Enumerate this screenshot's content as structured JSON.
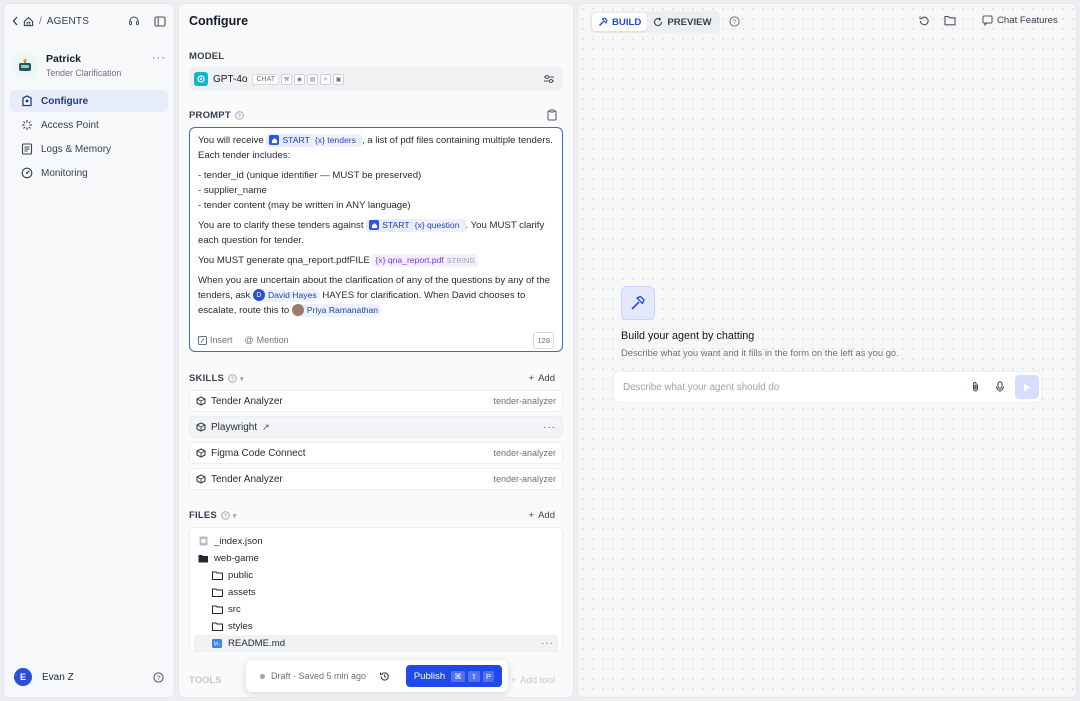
{
  "sidebar": {
    "breadcrumb": "AGENTS",
    "separator": "/",
    "agent_name": "Patrick",
    "agent_subtitle": "Tender Clarification",
    "nav": [
      {
        "label": "Configure",
        "icon": "agent-icon",
        "active": true
      },
      {
        "label": "Access Point",
        "icon": "access-point-icon",
        "active": false
      },
      {
        "label": "Logs & Memory",
        "icon": "logs-icon",
        "active": false
      },
      {
        "label": "Monitoring",
        "icon": "monitoring-icon",
        "active": false
      }
    ],
    "user": {
      "initial": "E",
      "name": "Evan Z"
    }
  },
  "config": {
    "title": "Configure",
    "model": {
      "label": "MODEL",
      "name": "GPT-4o",
      "badge": "CHAT"
    },
    "prompt": {
      "label": "PROMPT",
      "p1_a": "You will receive",
      "start_label": "START",
      "var_tenders": "{x} tenders",
      "p1_b": ", a list of pdf files containing multiple tenders. Each tender includes:",
      "bullet1": "- tender_id (unique identifier — MUST be preserved)",
      "bullet2": "- supplier_name",
      "bullet3": "- tender content (may be written in ANY language)",
      "p3_a": "You are to clarify these tenders against",
      "var_question": "{x} question",
      "p3_b": ". You MUST clarify each question for tender.",
      "p4_a": "You MUST generate qna_report.pdfFILE",
      "var_report": "{x} qna_report.pdf",
      "var_report_type": "STRING",
      "p5_a": "When you are uncertain about the clarification of any of the questions by any of the tenders, ask",
      "person1_initial": "D",
      "person1_name": "David Hayes",
      "p5_b": "HAYES for clarification. When David chooses to escalate, route this to",
      "person2_name": "Priya Ramanathan",
      "insert_label": "Insert",
      "mention_label": "Mention",
      "char_count": "128"
    },
    "skills": {
      "label": "SKILLS",
      "add_label": "Add",
      "items": [
        {
          "name": "Tender Analyzer",
          "tag": "tender-analyzer"
        },
        {
          "name": "Playwright",
          "tag": ""
        },
        {
          "name": "Figma Code Connect",
          "tag": "tender-analyzer"
        },
        {
          "name": "Tender Analyzer",
          "tag": "tender-analyzer"
        }
      ]
    },
    "files": {
      "label": "FILES",
      "add_label": "Add",
      "items": [
        {
          "name": "_index.json",
          "type": "file"
        },
        {
          "name": "web-game",
          "type": "folder-open"
        },
        {
          "name": "public",
          "type": "folder"
        },
        {
          "name": "assets",
          "type": "folder"
        },
        {
          "name": "src",
          "type": "folder"
        },
        {
          "name": "styles",
          "type": "folder"
        },
        {
          "name": "README.md",
          "type": "markdown"
        }
      ]
    },
    "tools": {
      "label": "TOOLS",
      "add_label": "Add tool"
    },
    "publish": {
      "status": "Draft · Saved 5 min ago",
      "button": "Publish",
      "keys": [
        "⌘",
        "⇧",
        "P"
      ]
    }
  },
  "builder": {
    "tabs": [
      "BUILD",
      "PREVIEW"
    ],
    "chat_features": "Chat Features",
    "empty_title": "Build your agent by chatting",
    "empty_desc": "Describe what you want and it fills in the form on the left as you go.",
    "input_placeholder": "Describe what your agent should do"
  },
  "colors": {
    "accent": "#2049e8",
    "accent_light": "#e8edfd"
  }
}
